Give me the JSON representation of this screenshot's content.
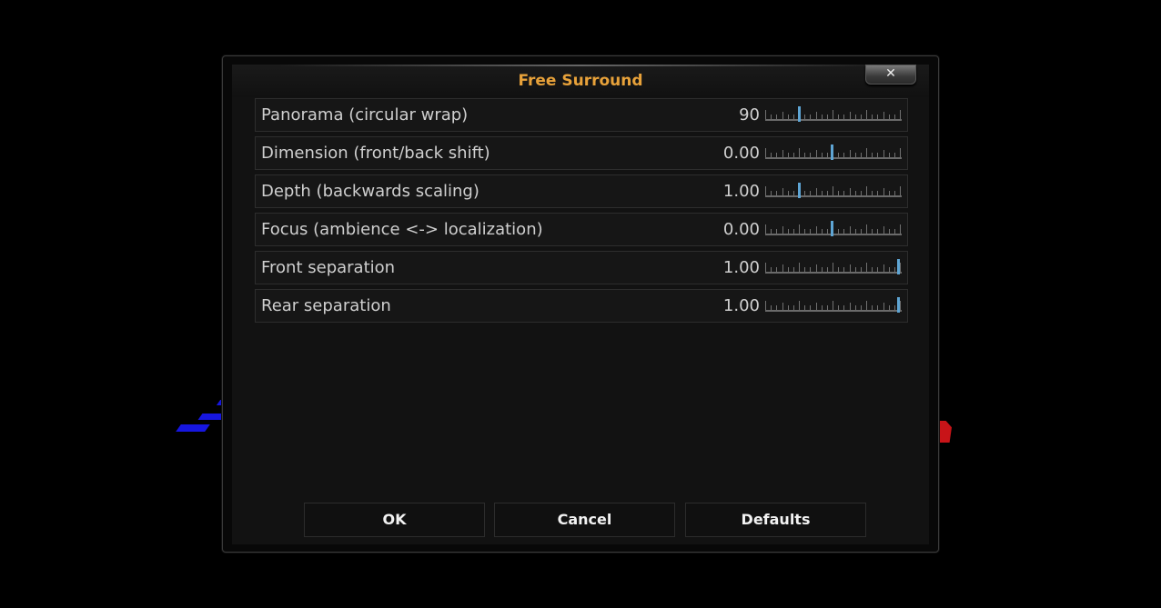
{
  "dialog": {
    "title": "Free Surround",
    "close_icon": "close-icon",
    "settings": [
      {
        "label": "Panorama (circular wrap)",
        "value": "90",
        "level": 0.25
      },
      {
        "label": "Dimension (front/back shift)",
        "value": "0.00",
        "level": 0.5
      },
      {
        "label": "Depth (backwards scaling)",
        "value": "1.00",
        "level": 0.25
      },
      {
        "label": "Focus (ambience <-> localization)",
        "value": "0.00",
        "level": 0.5
      },
      {
        "label": "Front separation",
        "value": "1.00",
        "level": 1.0
      },
      {
        "label": "Rear separation",
        "value": "1.00",
        "level": 1.0
      }
    ],
    "buttons": {
      "ok": "OK",
      "cancel": "Cancel",
      "defaults": "Defaults"
    }
  },
  "colors": {
    "title": "#e8a23a",
    "slider_knob": "#5ea5d4",
    "background_blue": "#1616e0",
    "background_red": "#c81418"
  }
}
